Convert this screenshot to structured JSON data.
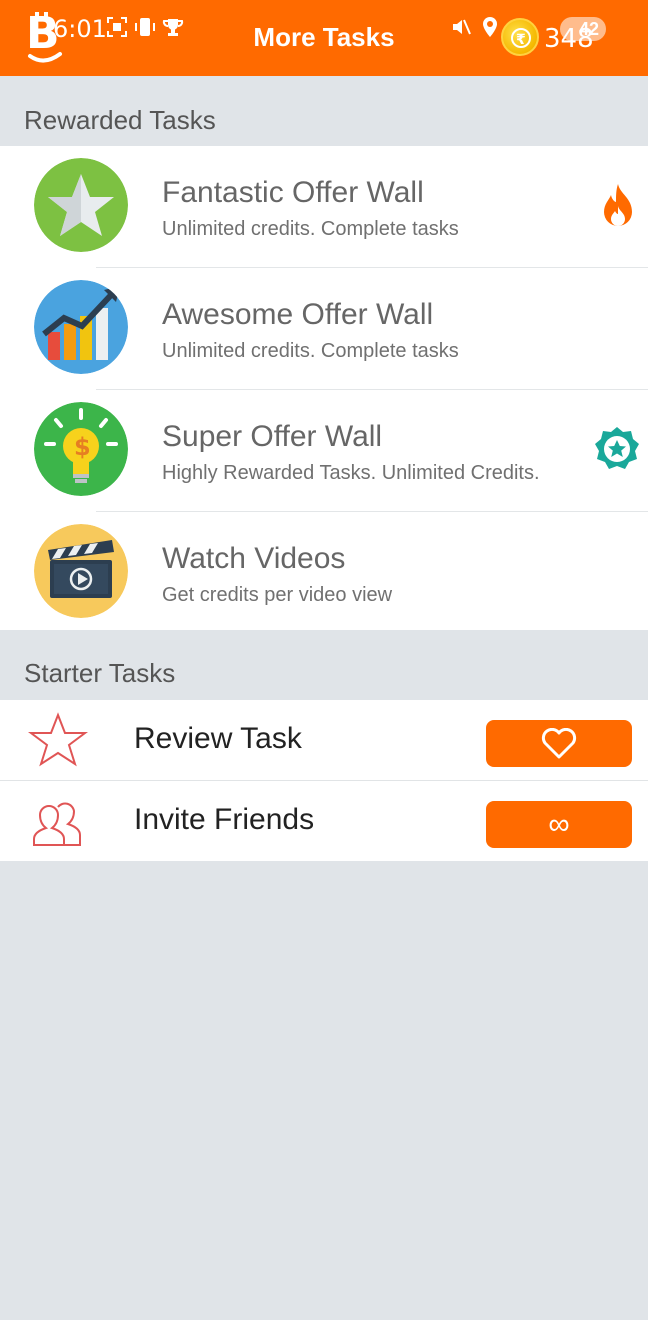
{
  "status_bar": {
    "time": "6:01",
    "battery": "42",
    "credits": "348"
  },
  "header": {
    "title": "More Tasks"
  },
  "rewarded": {
    "title": "Rewarded Tasks",
    "items": [
      {
        "name": "Fantastic Offer Wall",
        "desc": "Unlimited credits. Complete tasks",
        "badge": "fire-icon"
      },
      {
        "name": "Awesome Offer Wall",
        "desc": "Unlimited credits. Complete tasks",
        "badge": ""
      },
      {
        "name": "Super Offer Wall",
        "desc": "Highly Rewarded Tasks. Unlimited Credits.",
        "badge": "star-badge-icon"
      },
      {
        "name": "Watch Videos",
        "desc": "Get credits per video view",
        "badge": ""
      }
    ]
  },
  "starter": {
    "title": "Starter Tasks",
    "items": [
      {
        "name": "Review Task",
        "button_icon": "heart-icon"
      },
      {
        "name": "Invite Friends",
        "button_label": "∞"
      }
    ]
  },
  "colors": {
    "accent": "#ff6a00",
    "background": "#e0e4e8",
    "teal_badge": "#1aa89a"
  }
}
